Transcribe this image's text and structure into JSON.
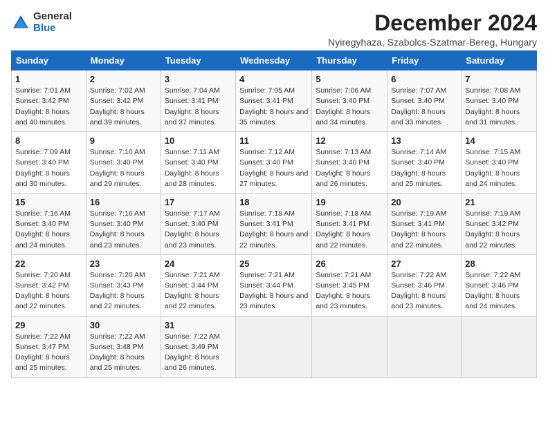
{
  "header": {
    "logo_general": "General",
    "logo_blue": "Blue",
    "title": "December 2024",
    "subtitle": "Nyiregyhaza, Szabolcs-Szatmar-Bereg, Hungary"
  },
  "weekdays": [
    "Sunday",
    "Monday",
    "Tuesday",
    "Wednesday",
    "Thursday",
    "Friday",
    "Saturday"
  ],
  "weeks": [
    [
      {
        "day": "1",
        "sunrise": "7:01 AM",
        "sunset": "3:42 PM",
        "daylight": "8 hours and 40 minutes."
      },
      {
        "day": "2",
        "sunrise": "7:02 AM",
        "sunset": "3:42 PM",
        "daylight": "8 hours and 39 minutes."
      },
      {
        "day": "3",
        "sunrise": "7:04 AM",
        "sunset": "3:41 PM",
        "daylight": "8 hours and 37 minutes."
      },
      {
        "day": "4",
        "sunrise": "7:05 AM",
        "sunset": "3:41 PM",
        "daylight": "8 hours and 35 minutes."
      },
      {
        "day": "5",
        "sunrise": "7:06 AM",
        "sunset": "3:40 PM",
        "daylight": "8 hours and 34 minutes."
      },
      {
        "day": "6",
        "sunrise": "7:07 AM",
        "sunset": "3:40 PM",
        "daylight": "8 hours and 33 minutes."
      },
      {
        "day": "7",
        "sunrise": "7:08 AM",
        "sunset": "3:40 PM",
        "daylight": "8 hours and 31 minutes."
      }
    ],
    [
      {
        "day": "8",
        "sunrise": "7:09 AM",
        "sunset": "3:40 PM",
        "daylight": "8 hours and 30 minutes."
      },
      {
        "day": "9",
        "sunrise": "7:10 AM",
        "sunset": "3:40 PM",
        "daylight": "8 hours and 29 minutes."
      },
      {
        "day": "10",
        "sunrise": "7:11 AM",
        "sunset": "3:40 PM",
        "daylight": "8 hours and 28 minutes."
      },
      {
        "day": "11",
        "sunrise": "7:12 AM",
        "sunset": "3:40 PM",
        "daylight": "8 hours and 27 minutes."
      },
      {
        "day": "12",
        "sunrise": "7:13 AM",
        "sunset": "3:40 PM",
        "daylight": "8 hours and 26 minutes."
      },
      {
        "day": "13",
        "sunrise": "7:14 AM",
        "sunset": "3:40 PM",
        "daylight": "8 hours and 25 minutes."
      },
      {
        "day": "14",
        "sunrise": "7:15 AM",
        "sunset": "3:40 PM",
        "daylight": "8 hours and 24 minutes."
      }
    ],
    [
      {
        "day": "15",
        "sunrise": "7:16 AM",
        "sunset": "3:40 PM",
        "daylight": "8 hours and 24 minutes."
      },
      {
        "day": "16",
        "sunrise": "7:16 AM",
        "sunset": "3:40 PM",
        "daylight": "8 hours and 23 minutes."
      },
      {
        "day": "17",
        "sunrise": "7:17 AM",
        "sunset": "3:40 PM",
        "daylight": "8 hours and 23 minutes."
      },
      {
        "day": "18",
        "sunrise": "7:18 AM",
        "sunset": "3:41 PM",
        "daylight": "8 hours and 22 minutes."
      },
      {
        "day": "19",
        "sunrise": "7:18 AM",
        "sunset": "3:41 PM",
        "daylight": "8 hours and 22 minutes."
      },
      {
        "day": "20",
        "sunrise": "7:19 AM",
        "sunset": "3:41 PM",
        "daylight": "8 hours and 22 minutes."
      },
      {
        "day": "21",
        "sunrise": "7:19 AM",
        "sunset": "3:42 PM",
        "daylight": "8 hours and 22 minutes."
      }
    ],
    [
      {
        "day": "22",
        "sunrise": "7:20 AM",
        "sunset": "3:42 PM",
        "daylight": "8 hours and 22 minutes."
      },
      {
        "day": "23",
        "sunrise": "7:20 AM",
        "sunset": "3:43 PM",
        "daylight": "8 hours and 22 minutes."
      },
      {
        "day": "24",
        "sunrise": "7:21 AM",
        "sunset": "3:44 PM",
        "daylight": "8 hours and 22 minutes."
      },
      {
        "day": "25",
        "sunrise": "7:21 AM",
        "sunset": "3:44 PM",
        "daylight": "8 hours and 23 minutes."
      },
      {
        "day": "26",
        "sunrise": "7:21 AM",
        "sunset": "3:45 PM",
        "daylight": "8 hours and 23 minutes."
      },
      {
        "day": "27",
        "sunrise": "7:22 AM",
        "sunset": "3:46 PM",
        "daylight": "8 hours and 23 minutes."
      },
      {
        "day": "28",
        "sunrise": "7:22 AM",
        "sunset": "3:46 PM",
        "daylight": "8 hours and 24 minutes."
      }
    ],
    [
      {
        "day": "29",
        "sunrise": "7:22 AM",
        "sunset": "3:47 PM",
        "daylight": "8 hours and 25 minutes."
      },
      {
        "day": "30",
        "sunrise": "7:22 AM",
        "sunset": "3:48 PM",
        "daylight": "8 hours and 25 minutes."
      },
      {
        "day": "31",
        "sunrise": "7:22 AM",
        "sunset": "3:49 PM",
        "daylight": "8 hours and 26 minutes."
      },
      null,
      null,
      null,
      null
    ]
  ]
}
